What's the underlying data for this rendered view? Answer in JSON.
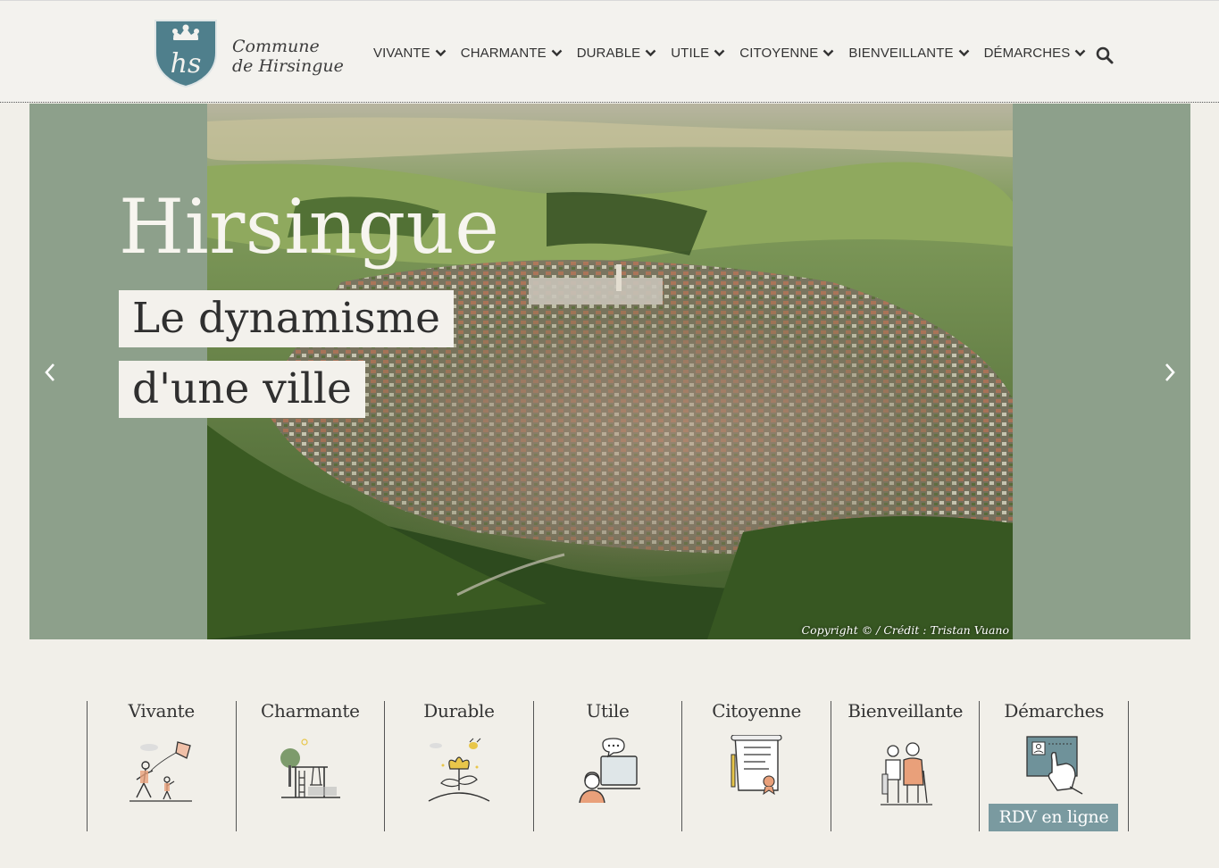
{
  "site": {
    "logo_line1": "Commune",
    "logo_line2": "de Hirsingue",
    "logo_monogram": "hs"
  },
  "nav": {
    "items": [
      {
        "label": "VIVANTE"
      },
      {
        "label": "CHARMANTE"
      },
      {
        "label": "DURABLE"
      },
      {
        "label": "UTILE"
      },
      {
        "label": "CITOYENNE"
      },
      {
        "label": "BIENVEILLANTE"
      },
      {
        "label": "DÉMARCHES"
      }
    ],
    "search_icon": "search-icon"
  },
  "hero": {
    "title": "Hirsingue",
    "line1": "Le dynamisme",
    "line2": "d'une ville",
    "credit": "Copyright © / Crédit : Tristan Vuano",
    "prev_icon": "chevron-left-icon",
    "next_icon": "chevron-right-icon"
  },
  "categories": [
    {
      "label": "Vivante",
      "icon": "kite-family-icon"
    },
    {
      "label": "Charmante",
      "icon": "playground-icon"
    },
    {
      "label": "Durable",
      "icon": "flower-bee-icon"
    },
    {
      "label": "Utile",
      "icon": "support-chat-icon"
    },
    {
      "label": "Citoyenne",
      "icon": "scroll-certificate-icon"
    },
    {
      "label": "Bienveillante",
      "icon": "elderly-couple-icon"
    },
    {
      "label": "Démarches",
      "icon": "online-appointment-icon",
      "button": "RDV en ligne"
    }
  ],
  "colors": {
    "background": "#f1efe9",
    "hero_green": "#8da08b",
    "logo_teal": "#4f7f8c",
    "button_teal": "#7a9aa0",
    "accent_yellow": "#e8c64a",
    "accent_orange": "#e9a07a"
  }
}
